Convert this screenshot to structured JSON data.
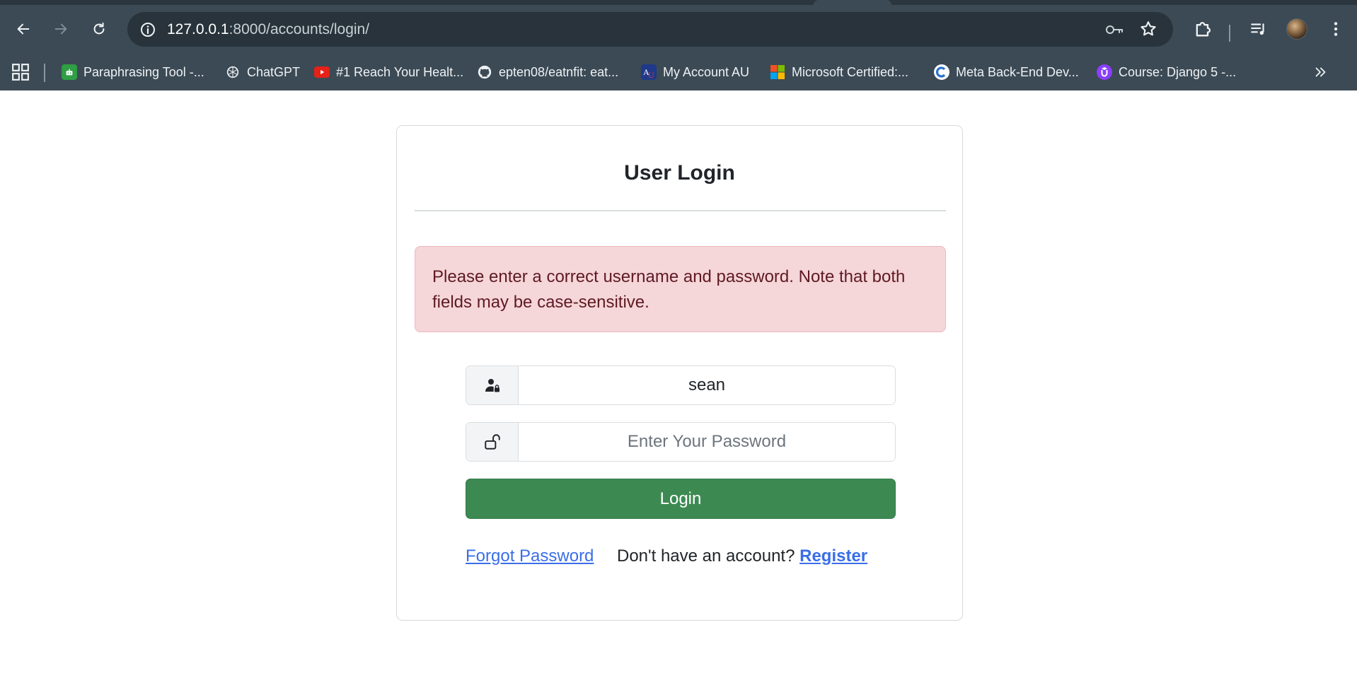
{
  "browser": {
    "url_host": "127.0.0.1",
    "url_rest": ":8000/accounts/login/",
    "bookmarks": [
      {
        "label": "Paraphrasing Tool -...",
        "icon": "paraphrasing-tool-icon",
        "color": "#2f9e44"
      },
      {
        "label": "ChatGPT",
        "icon": "chatgpt-icon",
        "color": "#3c4a55"
      },
      {
        "label": "#1 Reach Your Healt...",
        "icon": "youtube-icon",
        "color": "#e62117"
      },
      {
        "label": "epten08/eatnfit: eat...",
        "icon": "github-icon",
        "color": "#3c4a55"
      },
      {
        "label": "My Account AU",
        "icon": "au-icon",
        "color": "#1f3a8a"
      },
      {
        "label": "Microsoft Certified:...",
        "icon": "microsoft-icon",
        "color": "#f25022"
      },
      {
        "label": "Meta Back-End Dev...",
        "icon": "coursera-icon",
        "color": "#2a73cc"
      },
      {
        "label": "Course: Django 5 -...",
        "icon": "udemy-icon",
        "color": "#8a3ffc"
      }
    ]
  },
  "page": {
    "title": "User Login",
    "error": "Please enter a correct username and password. Note that both fields may be case-sensitive.",
    "username_value": "sean",
    "password_placeholder": "Enter Your Password",
    "login_label": "Login",
    "forgot_label": "Forgot Password",
    "no_account_text": "Don't have an account?",
    "register_label": "Register"
  },
  "colors": {
    "chrome_bg": "#3c4a55",
    "login_button": "#3c8a52",
    "alert_bg": "#f5d6d9",
    "link": "#3a6ee8"
  }
}
